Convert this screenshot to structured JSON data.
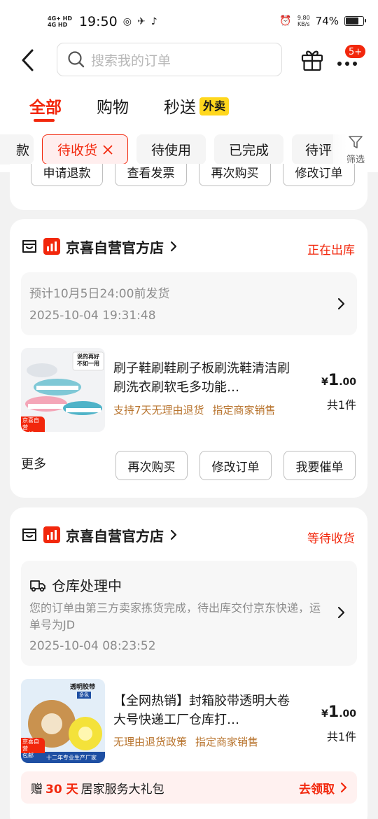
{
  "status_bar": {
    "net1": "4G+ HD",
    "net2": "4G HD",
    "time": "19:50",
    "speed_value": "9.80",
    "speed_unit": "KB/s",
    "battery": "74%",
    "battery_level": 0.74
  },
  "search": {
    "placeholder": "搜索我的订单"
  },
  "header": {
    "badge": "5+"
  },
  "tabs": [
    {
      "label": "全部",
      "active": true
    },
    {
      "label": "购物",
      "active": false
    },
    {
      "label": "秒送",
      "active": false,
      "tag": "外卖"
    }
  ],
  "filters": {
    "chips": [
      "款",
      "待收货",
      "待使用",
      "已完成",
      "待评"
    ],
    "filter_label": "筛选"
  },
  "order0": {
    "buttons": [
      "申请退款",
      "查看发票",
      "再次购买",
      "修改订单"
    ]
  },
  "order1": {
    "shop": "京喜自营官方店",
    "status": "正在出库",
    "ship_line": "预计10月5日24:00前发货",
    "ship_time": "2025-10-04 19:31:48",
    "title": "刷子鞋刷鞋刷子板刷洗鞋清洁刷刷洗衣刷软毛多功能…",
    "tags": [
      "支持7天无理由退货",
      "指定商家销售"
    ],
    "price_symbol": "¥",
    "price_int": "1",
    "price_dec": ".00",
    "qty": "共1件",
    "img_text1": "说的再好",
    "img_text2": "不如一用",
    "img_tag1": "京喜自营",
    "img_tag2": "包邮",
    "more": "更多",
    "buttons": [
      "再次购买",
      "修改订单",
      "我要催单"
    ]
  },
  "order2": {
    "shop": "京喜自营官方店",
    "status": "等待收货",
    "ship_title": "仓库处理中",
    "ship_desc": "您的订单由第三方卖家拣货完成，待出库交付京东快递，运单号为JD",
    "ship_time": "2025-10-04 08:23:52",
    "title": "【全网热销】封箱胶带透明大卷大号快递工厂仓库打…",
    "tags": [
      "无理由退货政策",
      "指定商家销售"
    ],
    "price_symbol": "¥",
    "price_int": "1",
    "price_dec": ".00",
    "qty": "共1件",
    "img_text1": "透明胶带",
    "img_text2": "多色",
    "img_text3": "十二年专业生产厂家",
    "img_tag1": "京喜自营",
    "img_tag2": "包邮",
    "promo_prefix": "赠",
    "promo_days": "30 天",
    "promo_suffix": "居家服务大礼包",
    "promo_link": "去领取"
  },
  "colors": {
    "brand_red": "#f2270c",
    "tag_yellow": "#ffd71d",
    "tag_brown": "#b8742e",
    "bg": "#f2f2f2"
  },
  "icons": [
    "back-arrow-icon",
    "search-icon",
    "gift-icon",
    "more-dots-icon",
    "close-icon",
    "filter-icon",
    "shop-store-icon",
    "chevron-right-icon",
    "truck-icon"
  ]
}
